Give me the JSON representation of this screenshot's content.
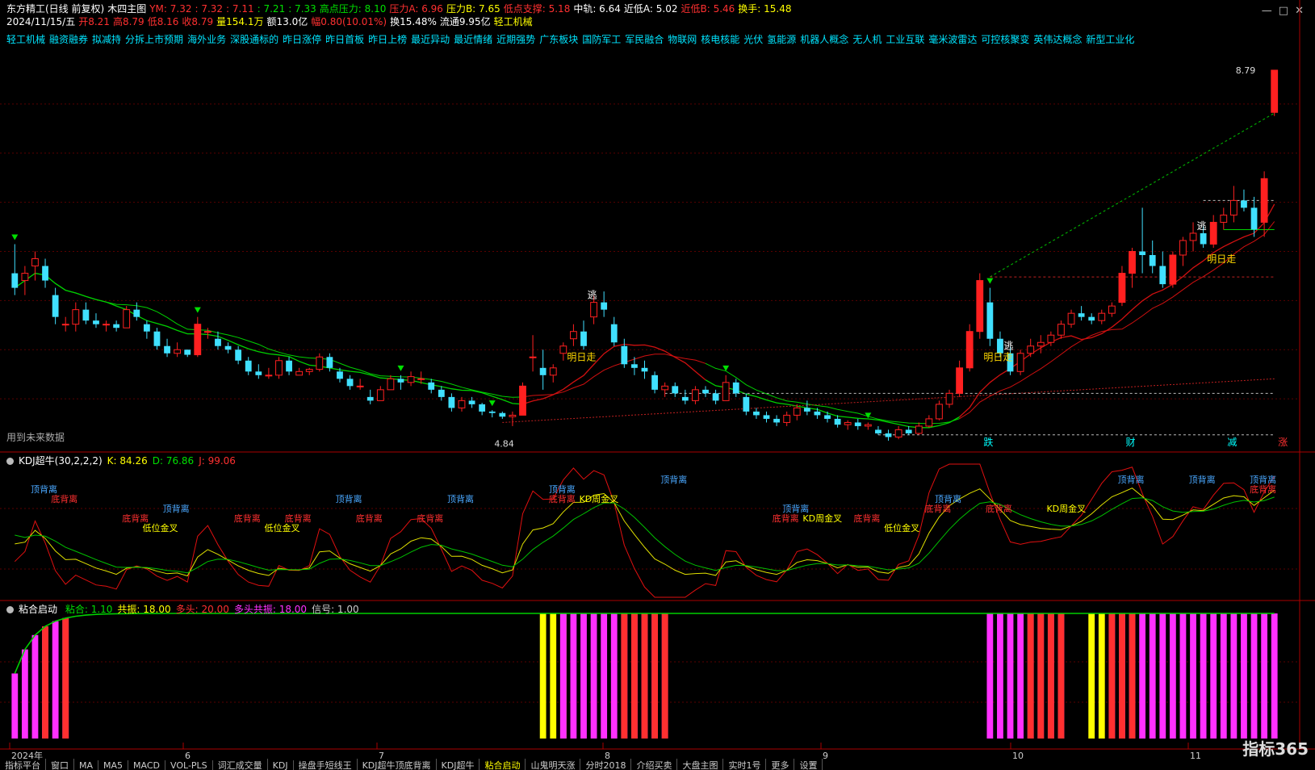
{
  "header": {
    "row1": [
      {
        "text": "东方精工(日线 前复权)",
        "color": "#ffffff"
      },
      {
        "text": "木四主图",
        "color": "#ffffff"
      },
      {
        "text": "YM: 7.32",
        "color": "#ff3030"
      },
      {
        "text": ": 7.32",
        "color": "#ff3030"
      },
      {
        "text": ": 7.11",
        "color": "#ff3030"
      },
      {
        "text": ": 7.21",
        "color": "#00e000"
      },
      {
        "text": ": 7.33",
        "color": "#00e000"
      },
      {
        "text": "高点压力: 8.10",
        "color": "#00e000"
      },
      {
        "text": "压力A: 6.96",
        "color": "#ff3030"
      },
      {
        "text": "压力B: 7.65",
        "color": "#ffff00"
      },
      {
        "text": "低点支撑: 5.18",
        "color": "#ff3030"
      },
      {
        "text": "中轨: 6.64",
        "color": "#ffffff"
      },
      {
        "text": "近低A: 5.02",
        "color": "#ffffff"
      },
      {
        "text": "近低B: 5.46",
        "color": "#ff3030"
      },
      {
        "text": "换手: 15.48",
        "color": "#ffff00"
      }
    ],
    "row2": [
      {
        "text": "2024/11/15/五",
        "color": "#ffffff"
      },
      {
        "text": "开8.21",
        "color": "#ff3030"
      },
      {
        "text": "高8.79",
        "color": "#ff3030"
      },
      {
        "text": "低8.16",
        "color": "#ff3030"
      },
      {
        "text": "收8.79",
        "color": "#ff3030"
      },
      {
        "text": "量154.1万",
        "color": "#ffff00"
      },
      {
        "text": "额13.0亿",
        "color": "#ffffff"
      },
      {
        "text": "幅0.80(10.01%)",
        "color": "#ff3030"
      },
      {
        "text": "换15.48%",
        "color": "#ffffff"
      },
      {
        "text": "流通9.95亿",
        "color": "#ffffff"
      },
      {
        "text": "轻工机械",
        "color": "#ffff00"
      }
    ]
  },
  "tags": [
    "轻工机械",
    "融资融券",
    "拟减持",
    "分拆上市预期",
    "海外业务",
    "深股通标的",
    "昨日涨停",
    "昨日首板",
    "昨日上榜",
    "最近异动",
    "最近情绪",
    "近期强势",
    "广东板块",
    "国防军工",
    "军民融合",
    "物联网",
    "核电核能",
    "光伏",
    "氢能源",
    "机器人概念",
    "无人机",
    "工业互联",
    "毫米波雷达",
    "可控核聚变",
    "英伟达概念",
    "新型工业化"
  ],
  "main_notes": {
    "future_data": "用到未来数据",
    "low_label": "4.84",
    "top_label": "8.79"
  },
  "kdj_panel": {
    "title": "KDJ超牛(30,2,2,2)",
    "k": "K: 84.26",
    "d": "D: 76.86",
    "j": "J: 99.06"
  },
  "bond_panel": {
    "title": "粘合启动",
    "items": [
      {
        "text": "粘合: 1.10",
        "color": "#00e000"
      },
      {
        "text": "共振: 18.00",
        "color": "#ffff00"
      },
      {
        "text": "多头: 20.00",
        "color": "#ff3030"
      },
      {
        "text": "多头共振: 18.00",
        "color": "#ff30ff"
      },
      {
        "text": "信号: 1.00",
        "color": "#cccccc"
      }
    ]
  },
  "bottom_tabs": [
    "指标平台",
    "窗口",
    "MA",
    "MA5",
    "MACD",
    "VOL-PLS",
    "词汇成交量",
    "KDJ",
    "操盘手短线王",
    "KDJ超牛顶底背离",
    "KDJ超牛",
    "粘合启动",
    "山鬼明天涨",
    "分时2018",
    "介绍买卖",
    "大盘主图",
    "实时1号",
    "更多",
    "设置"
  ],
  "logo_text": "指标365",
  "controls": [
    "—",
    "□",
    "✕"
  ],
  "chart_data": {
    "type": "candlestick",
    "title": "东方精工(日线 前复权)",
    "dates_axis_labels": [
      "2024年",
      "6",
      "7",
      "8",
      "9",
      "10",
      "11"
    ],
    "candles": [
      [
        6.0,
        6.4,
        5.7,
        5.8
      ],
      [
        5.9,
        6.1,
        5.7,
        6.0
      ],
      [
        6.1,
        6.3,
        5.9,
        6.2
      ],
      [
        6.1,
        6.2,
        5.8,
        5.9
      ],
      [
        5.7,
        5.8,
        5.3,
        5.4
      ],
      [
        5.3,
        5.4,
        5.2,
        5.3
      ],
      [
        5.3,
        5.6,
        5.2,
        5.5
      ],
      [
        5.5,
        5.6,
        5.3,
        5.35
      ],
      [
        5.35,
        5.45,
        5.25,
        5.3
      ],
      [
        5.3,
        5.35,
        5.2,
        5.3
      ],
      [
        5.3,
        5.35,
        5.2,
        5.25
      ],
      [
        5.25,
        5.55,
        5.25,
        5.5
      ],
      [
        5.5,
        5.6,
        5.35,
        5.4
      ],
      [
        5.3,
        5.35,
        5.1,
        5.2
      ],
      [
        5.2,
        5.25,
        4.95,
        5.0
      ],
      [
        5.0,
        5.1,
        4.85,
        4.9
      ],
      [
        4.9,
        5.05,
        4.85,
        4.95
      ],
      [
        4.95,
        4.95,
        4.85,
        4.88
      ],
      [
        4.88,
        5.4,
        4.85,
        5.3
      ],
      [
        5.2,
        5.25,
        5.1,
        5.2
      ],
      [
        5.1,
        5.2,
        4.95,
        5.0
      ],
      [
        5.0,
        5.05,
        4.9,
        4.95
      ],
      [
        4.95,
        5.0,
        4.75,
        4.8
      ],
      [
        4.8,
        4.85,
        4.6,
        4.65
      ],
      [
        4.65,
        4.75,
        4.55,
        4.6
      ],
      [
        4.6,
        4.7,
        4.55,
        4.6
      ],
      [
        4.6,
        4.85,
        4.55,
        4.8
      ],
      [
        4.8,
        4.85,
        4.6,
        4.65
      ],
      [
        4.6,
        4.7,
        4.6,
        4.65
      ],
      [
        4.65,
        4.7,
        4.6,
        4.68
      ],
      [
        4.68,
        4.9,
        4.65,
        4.85
      ],
      [
        4.85,
        4.9,
        4.65,
        4.7
      ],
      [
        4.65,
        4.7,
        4.5,
        4.55
      ],
      [
        4.55,
        4.6,
        4.4,
        4.45
      ],
      [
        4.45,
        4.55,
        4.4,
        4.45
      ],
      [
        4.3,
        4.4,
        4.2,
        4.25
      ],
      [
        4.25,
        4.45,
        4.25,
        4.4
      ],
      [
        4.4,
        4.6,
        4.4,
        4.55
      ],
      [
        4.55,
        4.6,
        4.4,
        4.5
      ],
      [
        4.5,
        4.65,
        4.45,
        4.58
      ],
      [
        4.55,
        4.65,
        4.48,
        4.55
      ],
      [
        4.5,
        4.55,
        4.35,
        4.4
      ],
      [
        4.4,
        4.45,
        4.25,
        4.3
      ],
      [
        4.3,
        4.35,
        4.1,
        4.15
      ],
      [
        4.15,
        4.3,
        4.1,
        4.25
      ],
      [
        4.25,
        4.3,
        4.15,
        4.2
      ],
      [
        4.2,
        4.22,
        4.05,
        4.1
      ],
      [
        4.1,
        4.12,
        4.02,
        4.08
      ],
      [
        4.08,
        4.1,
        4.0,
        4.03
      ],
      [
        4.03,
        4.1,
        3.9,
        4.05
      ],
      [
        4.05,
        4.5,
        4.05,
        4.45
      ],
      [
        4.85,
        5.15,
        4.65,
        4.85
      ],
      [
        4.7,
        4.95,
        4.4,
        4.6
      ],
      [
        4.6,
        4.75,
        4.5,
        4.7
      ],
      [
        4.9,
        5.05,
        4.8,
        5.0
      ],
      [
        5.1,
        5.3,
        5.0,
        5.2
      ],
      [
        5.2,
        5.35,
        4.95,
        5.0
      ],
      [
        5.4,
        5.7,
        5.3,
        5.6
      ],
      [
        5.6,
        5.75,
        5.4,
        5.5
      ],
      [
        5.3,
        5.4,
        5.0,
        5.05
      ],
      [
        5.0,
        5.1,
        4.7,
        4.75
      ],
      [
        4.75,
        4.85,
        4.6,
        4.7
      ],
      [
        4.7,
        4.8,
        4.55,
        4.65
      ],
      [
        4.6,
        4.65,
        4.35,
        4.4
      ],
      [
        4.4,
        4.5,
        4.3,
        4.45
      ],
      [
        4.45,
        4.5,
        4.3,
        4.35
      ],
      [
        4.3,
        4.4,
        4.2,
        4.25
      ],
      [
        4.25,
        4.45,
        4.2,
        4.4
      ],
      [
        4.4,
        4.45,
        4.3,
        4.35
      ],
      [
        4.35,
        4.4,
        4.2,
        4.25
      ],
      [
        4.25,
        4.6,
        4.25,
        4.5
      ],
      [
        4.5,
        4.55,
        4.3,
        4.35
      ],
      [
        4.3,
        4.35,
        4.05,
        4.1
      ],
      [
        4.1,
        4.15,
        4.0,
        4.05
      ],
      [
        4.05,
        4.1,
        3.95,
        4.0
      ],
      [
        4.0,
        4.05,
        3.9,
        3.95
      ],
      [
        3.95,
        4.1,
        3.9,
        4.05
      ],
      [
        4.05,
        4.2,
        3.98,
        4.15
      ],
      [
        4.15,
        4.25,
        4.05,
        4.1
      ],
      [
        4.1,
        4.15,
        4.0,
        4.05
      ],
      [
        4.05,
        4.1,
        3.95,
        4.0
      ],
      [
        4.0,
        4.05,
        3.88,
        3.92
      ],
      [
        3.92,
        3.98,
        3.85,
        3.95
      ],
      [
        3.95,
        4.0,
        3.85,
        3.9
      ],
      [
        3.9,
        3.95,
        3.85,
        3.92
      ],
      [
        3.85,
        3.9,
        3.78,
        3.8
      ],
      [
        3.8,
        3.85,
        3.7,
        3.75
      ],
      [
        3.75,
        3.9,
        3.72,
        3.85
      ],
      [
        3.85,
        3.9,
        3.78,
        3.8
      ],
      [
        3.8,
        3.95,
        3.78,
        3.9
      ],
      [
        3.9,
        4.05,
        3.88,
        4.0
      ],
      [
        4.0,
        4.25,
        3.98,
        4.2
      ],
      [
        4.2,
        4.4,
        4.15,
        4.35
      ],
      [
        4.35,
        4.8,
        4.3,
        4.7
      ],
      [
        4.7,
        5.3,
        4.65,
        5.2
      ],
      [
        5.2,
        6.0,
        5.1,
        5.9
      ],
      [
        5.6,
        5.8,
        5.0,
        5.1
      ],
      [
        5.1,
        5.2,
        4.85,
        4.9
      ],
      [
        4.9,
        5.0,
        4.6,
        4.65
      ],
      [
        4.65,
        4.95,
        4.6,
        4.9
      ],
      [
        4.9,
        5.1,
        4.85,
        5.0
      ],
      [
        5.0,
        5.15,
        4.9,
        5.05
      ],
      [
        5.05,
        5.2,
        5.0,
        5.15
      ],
      [
        5.15,
        5.35,
        5.1,
        5.3
      ],
      [
        5.3,
        5.5,
        5.25,
        5.45
      ],
      [
        5.45,
        5.55,
        5.35,
        5.4
      ],
      [
        5.4,
        5.45,
        5.3,
        5.35
      ],
      [
        5.35,
        5.5,
        5.3,
        5.45
      ],
      [
        5.45,
        5.6,
        5.4,
        5.55
      ],
      [
        5.6,
        6.1,
        5.55,
        6.0
      ],
      [
        6.0,
        6.35,
        5.8,
        6.3
      ],
      [
        6.3,
        6.9,
        6.0,
        6.25
      ],
      [
        6.25,
        6.45,
        6.0,
        6.1
      ],
      [
        6.1,
        6.3,
        5.8,
        5.85
      ],
      [
        5.85,
        6.3,
        5.8,
        6.25
      ],
      [
        6.25,
        6.5,
        6.1,
        6.45
      ],
      [
        6.45,
        6.7,
        6.3,
        6.55
      ],
      [
        6.55,
        6.65,
        6.35,
        6.4
      ],
      [
        6.4,
        6.8,
        6.35,
        6.7
      ],
      [
        6.7,
        6.9,
        6.6,
        6.8
      ],
      [
        6.8,
        7.2,
        6.7,
        7.0
      ],
      [
        7.0,
        7.15,
        6.85,
        6.9
      ],
      [
        6.9,
        7.05,
        6.5,
        6.6
      ],
      [
        6.7,
        7.4,
        6.5,
        7.3
      ],
      [
        8.21,
        8.79,
        8.16,
        8.79
      ]
    ],
    "ylim": [
      3.6,
      9.0
    ],
    "annotations": [
      {
        "index": 55,
        "text": "明日走",
        "color": "#ffd800"
      },
      {
        "index": 96,
        "text": "明日走",
        "color": "#ffd800"
      },
      {
        "index": 118,
        "text": "明日走",
        "color": "#ffd800"
      },
      {
        "index": 57,
        "text": "逃",
        "color": "#ffffff"
      },
      {
        "index": 98,
        "text": "逃",
        "color": "#ffffff"
      },
      {
        "index": 117,
        "text": "逃",
        "color": "#ffffff"
      },
      {
        "index": 96,
        "text": "跌",
        "color": "#00ffff"
      },
      {
        "index": 110,
        "text": "财",
        "color": "#00ffff"
      },
      {
        "index": 120,
        "text": "减",
        "color": "#00ffff"
      },
      {
        "index": 125,
        "text": "涨",
        "color": "#ff3030"
      }
    ],
    "kdj_labels": [
      {
        "index": 3,
        "text": "顶背离",
        "color": "#4aa8ff",
        "row": 0
      },
      {
        "index": 5,
        "text": "底背离",
        "color": "#ff3030",
        "row": 1
      },
      {
        "index": 12,
        "text": "底背离",
        "color": "#ff3030",
        "row": 3
      },
      {
        "index": 16,
        "text": "顶背离",
        "color": "#4aa8ff",
        "row": 2
      },
      {
        "index": 14,
        "text": "低位金叉",
        "color": "#ffff00",
        "row": 4
      },
      {
        "index": 23,
        "text": "底背离",
        "color": "#ff3030",
        "row": 3
      },
      {
        "index": 26,
        "text": "低位金叉",
        "color": "#ffff00",
        "row": 4
      },
      {
        "index": 28,
        "text": "底背离",
        "color": "#ff3030",
        "row": 3
      },
      {
        "index": 33,
        "text": "顶背离",
        "color": "#4aa8ff",
        "row": 1
      },
      {
        "index": 35,
        "text": "底背离",
        "color": "#ff3030",
        "row": 3
      },
      {
        "index": 41,
        "text": "底背离",
        "color": "#ff3030",
        "row": 3
      },
      {
        "index": 44,
        "text": "顶背离",
        "color": "#4aa8ff",
        "row": 1
      },
      {
        "index": 54,
        "text": "顶背离",
        "color": "#4aa8ff",
        "row": 0
      },
      {
        "index": 54,
        "text": "底背离",
        "color": "#ff3030",
        "row": 1
      },
      {
        "index": 57,
        "text": "KD周金叉",
        "color": "#ffff00",
        "row": 1
      },
      {
        "index": 65,
        "text": "顶背离",
        "color": "#4aa8ff",
        "row": -1
      },
      {
        "index": 77,
        "text": "顶背离",
        "color": "#4aa8ff",
        "row": 2
      },
      {
        "index": 76,
        "text": "底背离",
        "color": "#ff3030",
        "row": 3
      },
      {
        "index": 79,
        "text": "KD周金叉",
        "color": "#ffff00",
        "row": 3
      },
      {
        "index": 84,
        "text": "底背离",
        "color": "#ff3030",
        "row": 3
      },
      {
        "index": 87,
        "text": "低位金叉",
        "color": "#ffff00",
        "row": 4
      },
      {
        "index": 92,
        "text": "顶背离",
        "color": "#4aa8ff",
        "row": 1
      },
      {
        "index": 91,
        "text": "底背离",
        "color": "#ff3030",
        "row": 2
      },
      {
        "index": 97,
        "text": "底背离",
        "color": "#ff3030",
        "row": 2
      },
      {
        "index": 103,
        "text": "KD周金叉",
        "color": "#ffff00",
        "row": 2
      },
      {
        "index": 110,
        "text": "顶背离",
        "color": "#4aa8ff",
        "row": -1
      },
      {
        "index": 117,
        "text": "顶背离",
        "color": "#4aa8ff",
        "row": -1
      },
      {
        "index": 123,
        "text": "顶背离",
        "color": "#4aa8ff",
        "row": -1
      },
      {
        "index": 123,
        "text": "底背离",
        "color": "#ff3030",
        "row": 0
      }
    ],
    "bond_bars": [
      {
        "from": 0,
        "to": 5,
        "color": "#ff30ff"
      },
      {
        "from": 3,
        "to": 3,
        "color": "#ff3030"
      },
      {
        "from": 5,
        "to": 5,
        "color": "#ff3030"
      },
      {
        "from": 52,
        "to": 54,
        "color": "#ffff00"
      },
      {
        "from": 54,
        "to": 64,
        "color": "#ff30ff"
      },
      {
        "from": 60,
        "to": 64,
        "color": "#ff3030"
      },
      {
        "from": 96,
        "to": 103,
        "color": "#ff30ff"
      },
      {
        "from": 100,
        "to": 103,
        "color": "#ff3030"
      },
      {
        "from": 106,
        "to": 107,
        "color": "#ffff00"
      },
      {
        "from": 108,
        "to": 125,
        "color": "#ff30ff"
      },
      {
        "from": 108,
        "to": 110,
        "color": "#ff3030"
      }
    ]
  }
}
